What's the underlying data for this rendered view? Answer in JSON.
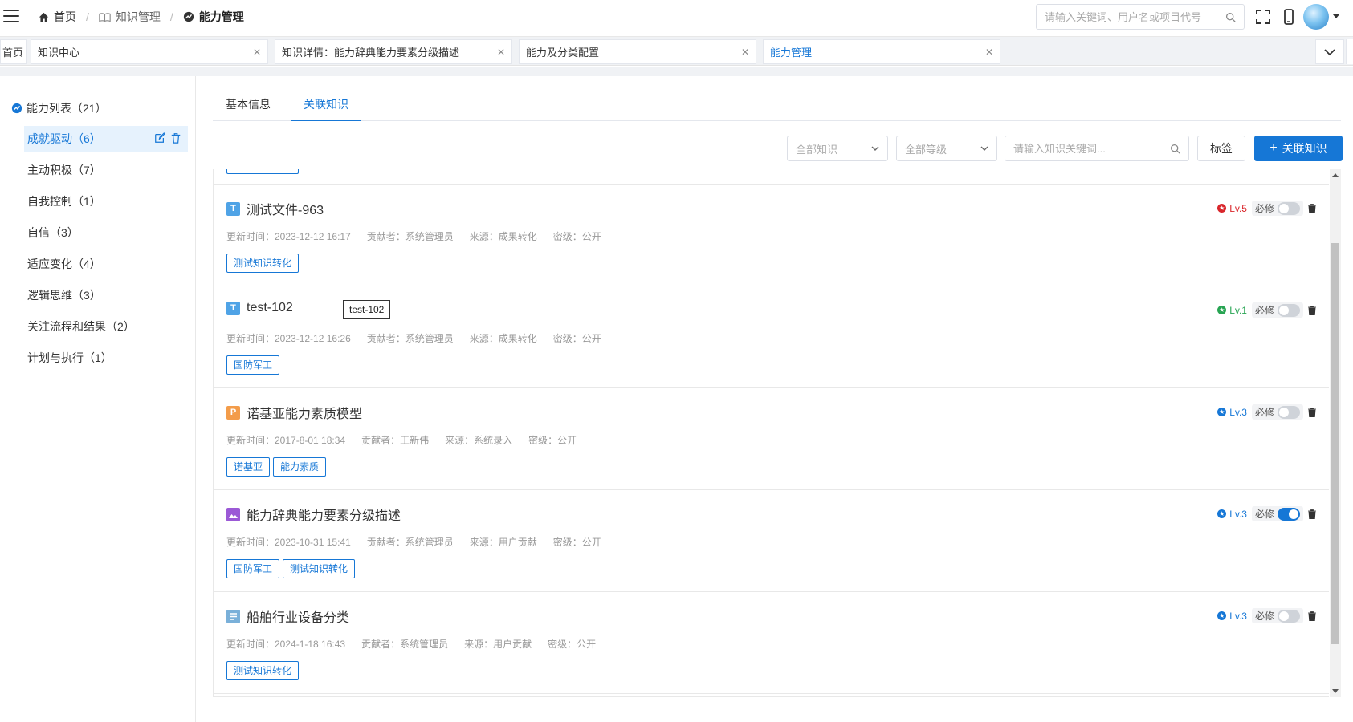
{
  "header": {
    "breadcrumb": [
      {
        "label": "首页",
        "icon": "home-icon"
      },
      {
        "label": "知识管理",
        "icon": "book-icon"
      },
      {
        "label": "能力管理",
        "icon": "ability-icon"
      }
    ],
    "search_placeholder": "请输入关键词、用户名或项目代号"
  },
  "tabs": [
    {
      "label": "首页",
      "active": false
    },
    {
      "label": "知识中心",
      "active": false
    },
    {
      "label": "知识详情：能力辞典能力要素分级描述",
      "active": false
    },
    {
      "label": "能力及分类配置",
      "active": false
    },
    {
      "label": "能力管理",
      "active": true
    }
  ],
  "sidebar": {
    "root_label": "能力列表（21）",
    "items": [
      {
        "label": "成就驱动（6）",
        "selected": true
      },
      {
        "label": "主动积极（7）"
      },
      {
        "label": "自我控制（1）"
      },
      {
        "label": "自信（3）"
      },
      {
        "label": "适应变化（4）"
      },
      {
        "label": "逻辑思维（3）"
      },
      {
        "label": "关注流程和结果（2）"
      },
      {
        "label": "计划与执行（1）"
      }
    ]
  },
  "content_tabs": [
    {
      "label": "基本信息",
      "active": false
    },
    {
      "label": "关联知识",
      "active": true
    }
  ],
  "filters": {
    "knowledge_type": "全部知识",
    "level": "全部等级",
    "keyword_placeholder": "请输入知识关键词...",
    "tag_button": "标签",
    "link_button": "关联知识"
  },
  "colors": {
    "primary": "#1677d6",
    "lv_red": "#d9262b",
    "lv_green": "#27a452",
    "lv_blue": "#1677d6"
  },
  "knowledge": [
    {
      "title": "测试文件-963",
      "type_icon": "T",
      "type_color": "#4fa3e6",
      "updated": "更新时间：2023-12-12 16:17",
      "contributor": "贡献者：系统管理员",
      "source": "来源：成果转化",
      "secrecy": "密级：公开",
      "tags": [
        "测试知识转化"
      ],
      "level": "Lv.5",
      "level_color": "#d9262b",
      "required_label": "必修",
      "required": false
    },
    {
      "title": "test-102",
      "type_icon": "T",
      "type_color": "#4fa3e6",
      "updated": "更新时间：2023-12-12 16:26",
      "contributor": "贡献者：系统管理员",
      "source": "来源：成果转化",
      "secrecy": "密级：公开",
      "tags": [
        "国防军工"
      ],
      "level": "Lv.1",
      "level_color": "#27a452",
      "required_label": "必修",
      "required": false
    },
    {
      "title": "诺基亚能力素质模型",
      "type_icon": "P",
      "type_color": "#f39c4a",
      "updated": "更新时间：2017-8-01 18:34",
      "contributor": "贡献者：王新伟",
      "source": "来源：系统录入",
      "secrecy": "密级：公开",
      "tags": [
        "诺基亚",
        "能力素质"
      ],
      "level": "Lv.3",
      "level_color": "#1677d6",
      "required_label": "必修",
      "required": false
    },
    {
      "title": "能力辞典能力要素分级描述",
      "type_icon": "image",
      "type_color": "#9b59d6",
      "updated": "更新时间：2023-10-31 15:41",
      "contributor": "贡献者：系统管理员",
      "source": "来源：用户贡献",
      "secrecy": "密级：公开",
      "tags": [
        "国防军工",
        "测试知识转化"
      ],
      "level": "Lv.3",
      "level_color": "#1677d6",
      "required_label": "必修",
      "required": true
    },
    {
      "title": "船舶行业设备分类",
      "type_icon": "doc",
      "type_color": "#7ab0d9",
      "updated": "更新时间：2024-1-18 16:43",
      "contributor": "贡献者：系统管理员",
      "source": "来源：用户贡献",
      "secrecy": "密级：公开",
      "tags": [
        "测试知识转化"
      ],
      "level": "Lv.3",
      "level_color": "#1677d6",
      "required_label": "必修",
      "required": false
    }
  ],
  "tooltip": "test-102"
}
